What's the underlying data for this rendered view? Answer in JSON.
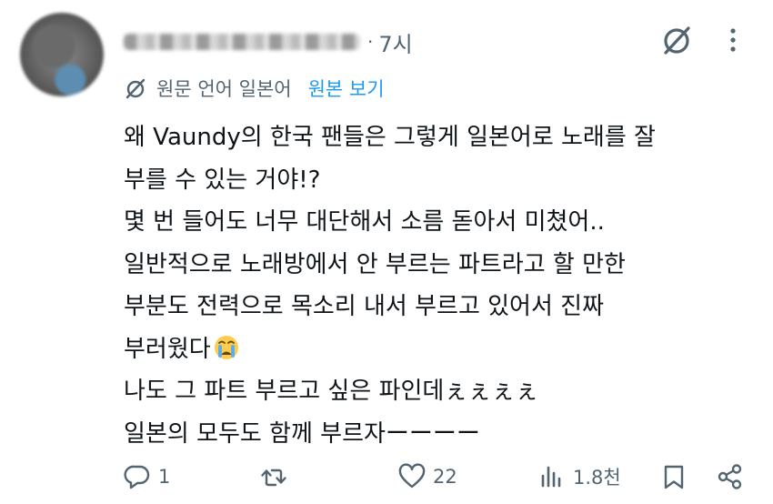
{
  "post": {
    "time": "7시",
    "dot": "·",
    "translation": {
      "label": "원문 언어 일본어",
      "view_original": "원본 보기"
    },
    "lines": [
      "왜 Vaundy의 한국 팬들은 그렇게 일본어로 노래를 잘",
      "부를 수 있는 거야!?",
      "몇 번 들어도 너무 대단해서 소름 돋아서 미쳤어..",
      "일반적으로 노래방에서 안 부르는 파트라고 할 만한",
      "부분도 전력으로 목소리 내서 부르고 있어서 진짜",
      "부러웠다",
      "나도 그 파트 부르고 싶은 파인데ぇぇぇぇ",
      "일본의 모두도 함께 부르자ーーーー"
    ],
    "actions": {
      "replies": "1",
      "likes": "22",
      "views": "1.8천"
    }
  },
  "colors": {
    "text": "#0f1419",
    "muted": "#536471",
    "link": "#1d9bf0"
  }
}
